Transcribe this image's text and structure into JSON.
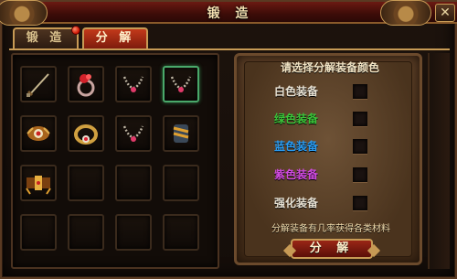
{
  "window": {
    "title": "锻 造",
    "close_glyph": "✕"
  },
  "tabs": [
    {
      "label": "锻 造",
      "active": false,
      "has_badge": true
    },
    {
      "label": "分 解",
      "active": true,
      "has_badge": false
    }
  ],
  "inventory": {
    "selected_index": 3,
    "items": [
      "sword-icon",
      "ring-icon",
      "necklace-icon",
      "necklace-icon",
      "amulet-icon",
      "bracelet-icon",
      "necklace-icon",
      "gauntlet-icon",
      "belt-icon",
      "",
      "",
      "",
      "",
      "",
      "",
      ""
    ]
  },
  "dismantle_panel": {
    "heading": "请选择分解装备颜色",
    "options": [
      {
        "label": "白色装备",
        "color": "#e8e2d4"
      },
      {
        "label": "绿色装备",
        "color": "#3cc43a"
      },
      {
        "label": "蓝色装备",
        "color": "#2a9bf0"
      },
      {
        "label": "紫色装备",
        "color": "#d04ae0"
      },
      {
        "label": "强化装备",
        "color": "#e8e2d4"
      }
    ],
    "hint": "分解装备有几率获得各类材料",
    "button_label": "分 解"
  }
}
